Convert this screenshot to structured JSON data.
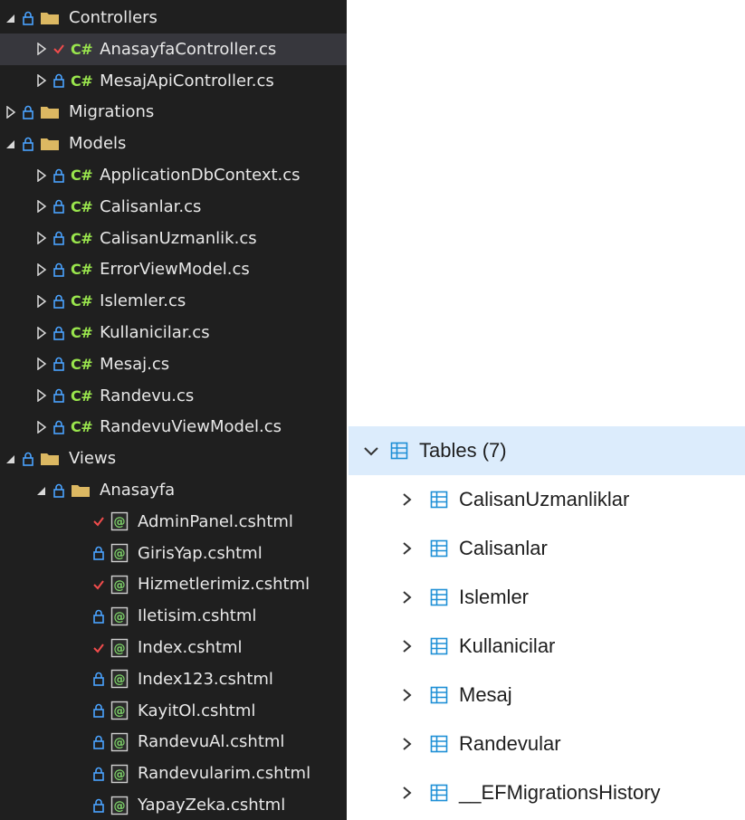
{
  "solution_explorer": {
    "rows": [
      {
        "label": "Controllers",
        "kind": "folder",
        "level": 0,
        "expanded": true,
        "status": "lock"
      },
      {
        "label": "AnasayfaController.cs",
        "kind": "cs",
        "level": 1,
        "expanded": false,
        "status": "check",
        "selected": true
      },
      {
        "label": "MesajApiController.cs",
        "kind": "cs",
        "level": 1,
        "expanded": false,
        "status": "lock"
      },
      {
        "label": "Migrations",
        "kind": "folder",
        "level": 0,
        "expanded": false,
        "status": "lock",
        "hollow": true
      },
      {
        "label": "Models",
        "kind": "folder",
        "level": 0,
        "expanded": true,
        "status": "lock"
      },
      {
        "label": "ApplicationDbContext.cs",
        "kind": "cs",
        "level": 1,
        "expanded": false,
        "status": "lock"
      },
      {
        "label": "Calisanlar.cs",
        "kind": "cs",
        "level": 1,
        "expanded": false,
        "status": "lock"
      },
      {
        "label": "CalisanUzmanlik.cs",
        "kind": "cs",
        "level": 1,
        "expanded": false,
        "status": "lock"
      },
      {
        "label": "ErrorViewModel.cs",
        "kind": "cs",
        "level": 1,
        "expanded": false,
        "status": "lock"
      },
      {
        "label": "Islemler.cs",
        "kind": "cs",
        "level": 1,
        "expanded": false,
        "status": "lock"
      },
      {
        "label": "Kullanicilar.cs",
        "kind": "cs",
        "level": 1,
        "expanded": false,
        "status": "lock"
      },
      {
        "label": "Mesaj.cs",
        "kind": "cs",
        "level": 1,
        "expanded": false,
        "status": "lock"
      },
      {
        "label": "Randevu.cs",
        "kind": "cs",
        "level": 1,
        "expanded": false,
        "status": "lock"
      },
      {
        "label": "RandevuViewModel.cs",
        "kind": "cs",
        "level": 1,
        "expanded": false,
        "status": "lock"
      },
      {
        "label": "Views",
        "kind": "folder",
        "level": 0,
        "expanded": true,
        "status": "lock"
      },
      {
        "label": "Anasayfa",
        "kind": "folder",
        "level": 1,
        "expanded": true,
        "status": "lock"
      },
      {
        "label": "AdminPanel.cshtml",
        "kind": "razor",
        "level": 2,
        "status": "check"
      },
      {
        "label": "GirisYap.cshtml",
        "kind": "razor",
        "level": 2,
        "status": "lock"
      },
      {
        "label": "Hizmetlerimiz.cshtml",
        "kind": "razor",
        "level": 2,
        "status": "check"
      },
      {
        "label": "Iletisim.cshtml",
        "kind": "razor",
        "level": 2,
        "status": "lock"
      },
      {
        "label": "Index.cshtml",
        "kind": "razor",
        "level": 2,
        "status": "check"
      },
      {
        "label": "Index123.cshtml",
        "kind": "razor",
        "level": 2,
        "status": "lock"
      },
      {
        "label": "KayitOl.cshtml",
        "kind": "razor",
        "level": 2,
        "status": "lock"
      },
      {
        "label": "RandevuAl.cshtml",
        "kind": "razor",
        "level": 2,
        "status": "lock"
      },
      {
        "label": "Randevularim.cshtml",
        "kind": "razor",
        "level": 2,
        "status": "lock"
      },
      {
        "label": "YapayZeka.cshtml",
        "kind": "razor",
        "level": 2,
        "status": "lock"
      }
    ],
    "cs_glyph": "C#",
    "razor_glyph": "@"
  },
  "db_tree": {
    "header": {
      "label": "Tables (7)"
    },
    "tables": [
      {
        "label": "CalisanUzmanliklar"
      },
      {
        "label": "Calisanlar"
      },
      {
        "label": "Islemler"
      },
      {
        "label": "Kullanicilar"
      },
      {
        "label": "Mesaj"
      },
      {
        "label": "Randevular"
      },
      {
        "label": "__EFMigrationsHistory"
      }
    ]
  },
  "colors": {
    "explorer_bg": "#1f1f1f",
    "explorer_selected": "#37373d",
    "cs_green": "#9ae64d",
    "folder_yellow": "#dcb862",
    "check_red": "#f14c4c",
    "db_header_bg": "#dcecfc",
    "table_icon_blue": "#1e8fd6"
  },
  "icons": {
    "expanded": "caret-down-icon",
    "collapsed": "caret-right-icon",
    "lock": "lock-icon",
    "check": "check-icon",
    "folder": "folder-icon",
    "csharp": "csharp-file-icon",
    "razor": "razor-file-icon",
    "table": "table-icon",
    "chevron_down": "chevron-down-icon",
    "chevron_right": "chevron-right-icon"
  }
}
